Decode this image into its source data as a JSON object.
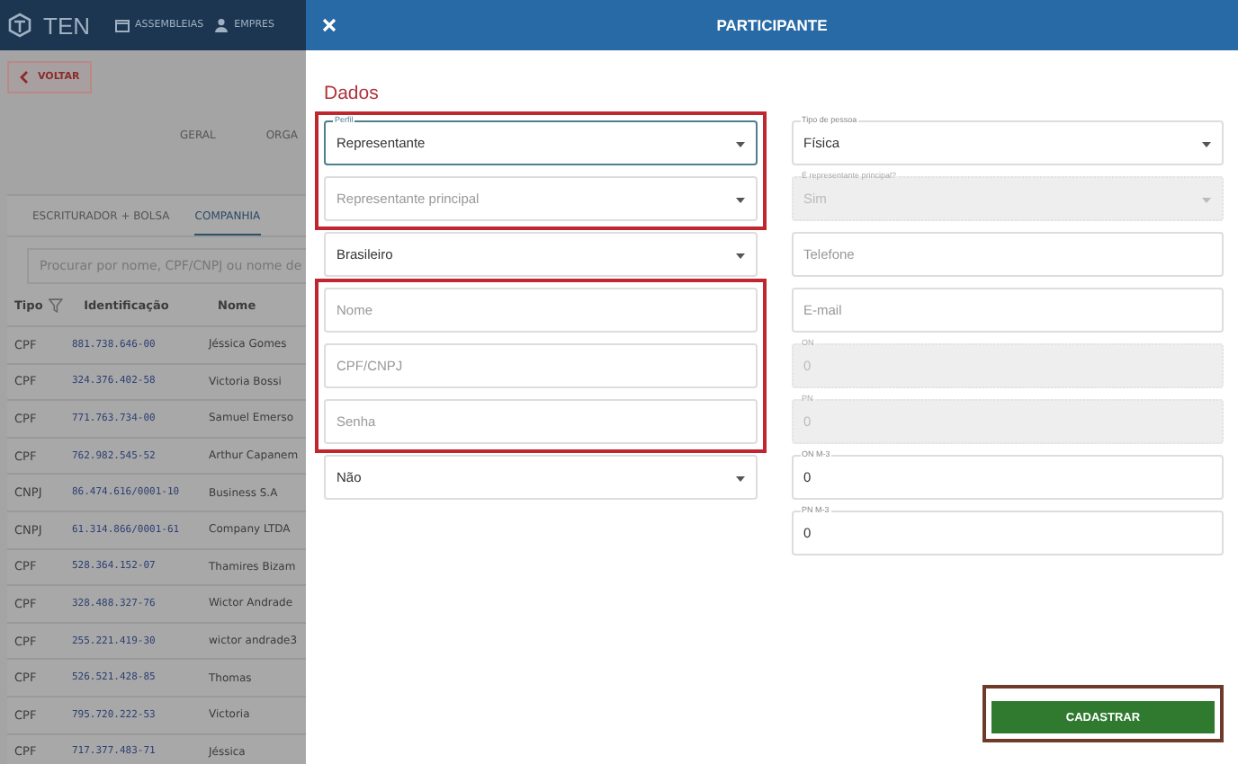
{
  "background": {
    "logo": "TEN",
    "nav": [
      "ASSEMBLEIAS",
      "EMPRES"
    ],
    "back_button": "VOLTAR",
    "section_tabs": [
      "GERAL",
      "ORGA"
    ],
    "sub_tabs": [
      {
        "label": "ESCRITURADOR + BOLSA",
        "selected": false
      },
      {
        "label": "COMPANHIA",
        "selected": true
      }
    ],
    "search": {
      "placeholder": "Procurar por nome, CPF/CNPJ ou nome de"
    },
    "table": {
      "columns": [
        "Tipo",
        "Identificação",
        "Nome"
      ],
      "rows": [
        [
          "CPF",
          "881.738.646-00",
          "Jéssica Gomes"
        ],
        [
          "CPF",
          "324.376.402-58",
          "Victoria Bossi"
        ],
        [
          "CPF",
          "771.763.734-00",
          "Samuel Emerso"
        ],
        [
          "CPF",
          "762.982.545-52",
          "Arthur Capanem"
        ],
        [
          "CNPJ",
          "86.474.616/0001-10",
          "Business S.A"
        ],
        [
          "CNPJ",
          "61.314.866/0001-61",
          "Company LTDA"
        ],
        [
          "CPF",
          "528.364.152-07",
          "Thamires Bizam"
        ],
        [
          "CPF",
          "328.488.327-76",
          "Wictor Andrade"
        ],
        [
          "CPF",
          "255.221.419-30",
          "wictor andrade3"
        ],
        [
          "CPF",
          "526.521.428-85",
          "Thomas"
        ],
        [
          "CPF",
          "795.720.222-53",
          "Victoria"
        ],
        [
          "CPF",
          "717.377.483-71",
          "Jéssica"
        ]
      ]
    }
  },
  "drawer": {
    "title": "PARTICIPANTE",
    "section": "Dados",
    "left_groups": [
      {
        "highlighted": true,
        "fields": [
          {
            "kind": "select",
            "label": "Perfil",
            "value": "Representante",
            "focused": true,
            "disabled": false
          },
          {
            "kind": "select",
            "placeholder": "Representante principal",
            "focused": false,
            "disabled": false
          }
        ]
      },
      {
        "highlighted": false,
        "fields": [
          {
            "kind": "select",
            "value": "Brasileiro",
            "focused": false,
            "disabled": false
          }
        ]
      },
      {
        "highlighted": true,
        "fields": [
          {
            "kind": "text",
            "placeholder": "Nome",
            "focused": false,
            "disabled": false
          },
          {
            "kind": "text",
            "placeholder": "CPF/CNPJ",
            "focused": false,
            "disabled": false
          },
          {
            "kind": "text",
            "placeholder": "Senha",
            "focused": false,
            "disabled": false
          }
        ]
      },
      {
        "highlighted": false,
        "fields": [
          {
            "kind": "select",
            "value": "Não",
            "focused": false,
            "disabled": false
          }
        ]
      }
    ],
    "right_fields": [
      {
        "kind": "select",
        "label": "Tipo de pessoa",
        "value": "Física",
        "focused": false,
        "disabled": false
      },
      {
        "kind": "select",
        "label": "É representante principal?",
        "value": "Sim",
        "focused": false,
        "disabled": true
      },
      {
        "kind": "text",
        "placeholder": "Telefone",
        "focused": false,
        "disabled": false
      },
      {
        "kind": "text",
        "placeholder": "E-mail",
        "focused": false,
        "disabled": false
      },
      {
        "kind": "text",
        "label": "ON",
        "value": "0",
        "focused": false,
        "disabled": true
      },
      {
        "kind": "text",
        "label": "PN",
        "value": "0",
        "focused": false,
        "disabled": true
      },
      {
        "kind": "text",
        "label": "ON M-3",
        "value": "0",
        "focused": false,
        "disabled": false
      },
      {
        "kind": "text",
        "label": "PN M-3",
        "value": "0",
        "focused": false,
        "disabled": false
      }
    ],
    "submit": {
      "label": "CADASTRAR",
      "highlighted": true
    }
  }
}
